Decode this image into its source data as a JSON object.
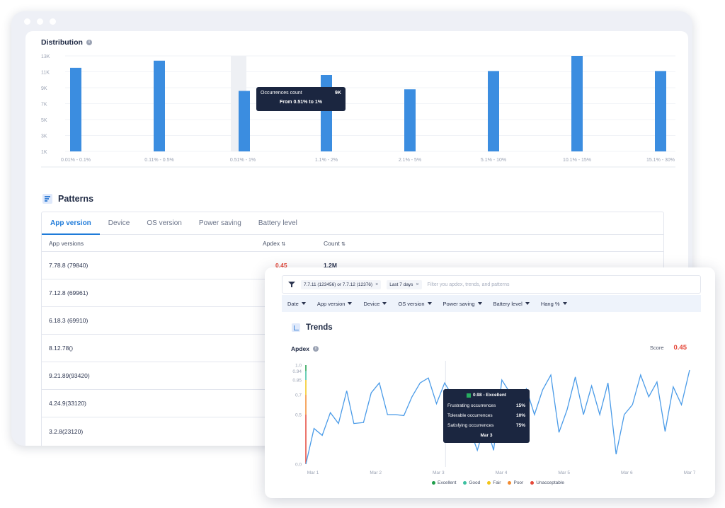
{
  "colors": {
    "bar": "#3b8de0",
    "bar_hover": "#3b8de0",
    "line": "#4a9be8",
    "score": "#e5483a",
    "excellent": "#1e9e4a",
    "good": "#3cc0a0",
    "fair": "#f2c518",
    "poor": "#f28a30",
    "unacceptable": "#e5483a"
  },
  "distribution": {
    "title": "Distribution",
    "info_icon": "info-icon",
    "tooltip": {
      "label": "Occurrences count",
      "value": "9K",
      "range": "From 0.51% to 1%"
    }
  },
  "patterns": {
    "title": "Patterns",
    "tabs": [
      "App version",
      "Device",
      "OS version",
      "Power saving",
      "Battery level"
    ],
    "active_tab": "App version",
    "columns": {
      "name": "App versions",
      "apdex": "Apdex",
      "count": "Count",
      "sort_icon": "sort-icon"
    },
    "rows": [
      {
        "name": "7.78.8 (79840)",
        "apdex": "0.45",
        "count": "1.2M"
      },
      {
        "name": "7.12.8 (69961)",
        "apdex": "",
        "count": ""
      },
      {
        "name": "6.18.3 (69910)",
        "apdex": "",
        "count": ""
      },
      {
        "name": "8.12.78()",
        "apdex": "",
        "count": ""
      },
      {
        "name": "9.21.89(93420)",
        "apdex": "",
        "count": ""
      },
      {
        "name": "4.24.9(33120)",
        "apdex": "",
        "count": ""
      },
      {
        "name": "3.2.8(23120)",
        "apdex": "",
        "count": ""
      }
    ]
  },
  "filters": {
    "chips": [
      "7.7.11 (123456) or 7.7.12 (12376)",
      "Last 7 days"
    ],
    "placeholder": "Filter you apdex, trends, and patterns",
    "dimensions": [
      "Date",
      "App version",
      "Device",
      "OS version",
      "Power saving",
      "Battery level",
      "Hang %"
    ]
  },
  "trends": {
    "title": "Trends",
    "apdex_label": "Apdex",
    "score_label": "Score",
    "score_value": "0.45",
    "tooltip": {
      "status": "0.98 - Excellent",
      "rows": [
        {
          "label": "Frustrating occurrences",
          "value": "15%"
        },
        {
          "label": "Tolerable occurrences",
          "value": "10%"
        },
        {
          "label": "Satisfying occurrences",
          "value": "75%"
        }
      ],
      "date": "Mar 3"
    },
    "legend": [
      "Excellent",
      "Good",
      "Fair",
      "Poor",
      "Unacceptable"
    ]
  },
  "chart_data": [
    {
      "type": "bar",
      "title": "Distribution",
      "categories": [
        "0.01% - 0.1%",
        "0.11% - 0.5%",
        "0.51% - 1%",
        "1.1% - 2%",
        "2.1% - 5%",
        "5.1% - 10%",
        "10.1% - 15%",
        "15.1% - 30%"
      ],
      "values": [
        11.5,
        12.4,
        8.6,
        10.6,
        8.8,
        11.1,
        13.0,
        11.1
      ],
      "y_ticks": [
        "1K",
        "3K",
        "5K",
        "7K",
        "9K",
        "11K",
        "13K"
      ],
      "ylim": [
        1,
        13
      ],
      "highlight_index": 2
    },
    {
      "type": "line",
      "title": "Apdex",
      "x_labels": [
        "Mar 1",
        "Mar 2",
        "Mar 3",
        "Mar 4",
        "Mar 5",
        "Mar 6",
        "Mar 7"
      ],
      "y_ticks": [
        "0.0",
        "0.5",
        "0.7",
        "0.85",
        "0.94",
        "1.0"
      ],
      "y_tick_values": [
        0.0,
        0.5,
        0.7,
        0.85,
        0.94,
        1.0
      ],
      "ylim": [
        0,
        1
      ],
      "x": [
        0.0,
        0.17,
        0.34,
        0.51,
        0.68,
        0.85,
        1.0,
        1.2,
        1.36,
        1.53,
        1.7,
        1.87,
        2.04,
        2.21,
        2.38,
        2.55,
        2.72,
        2.89,
        3.06,
        3.23,
        3.4,
        3.57,
        3.74,
        3.91,
        4.08,
        4.25,
        4.42,
        4.59,
        4.76,
        4.93,
        5.1,
        5.27,
        5.44,
        5.61,
        5.78,
        5.95,
        6.12,
        6.29,
        6.46,
        6.63,
        6.8,
        6.97,
        7.14,
        7.31,
        7.48,
        7.65,
        7.82,
        7.99
      ],
      "y": [
        0.0,
        0.36,
        0.29,
        0.52,
        0.41,
        0.74,
        0.41,
        0.42,
        0.72,
        0.82,
        0.5,
        0.5,
        0.49,
        0.68,
        0.82,
        0.87,
        0.61,
        0.82,
        0.68,
        0.51,
        0.37,
        0.14,
        0.42,
        0.14,
        0.85,
        0.72,
        0.57,
        0.76,
        0.5,
        0.75,
        0.9,
        0.32,
        0.55,
        0.88,
        0.5,
        0.79,
        0.5,
        0.82,
        0.1,
        0.5,
        0.6,
        0.9,
        0.68,
        0.83,
        0.33,
        0.78,
        0.6,
        0.95
      ],
      "highlight_x": 3
    }
  ]
}
